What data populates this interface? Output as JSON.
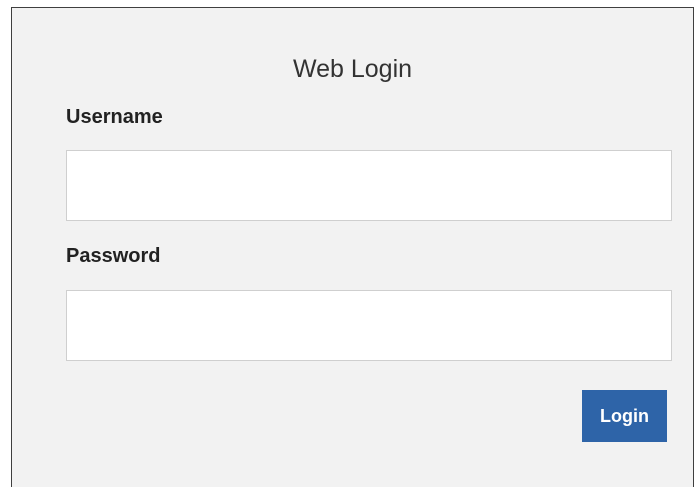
{
  "login_form": {
    "title": "Web Login",
    "username_label": "Username",
    "username_value": "",
    "password_label": "Password",
    "password_value": "",
    "login_button_label": "Login"
  },
  "colors": {
    "panel_background": "#f2f2f2",
    "button_background": "#2e64a8",
    "button_text": "#ffffff"
  }
}
